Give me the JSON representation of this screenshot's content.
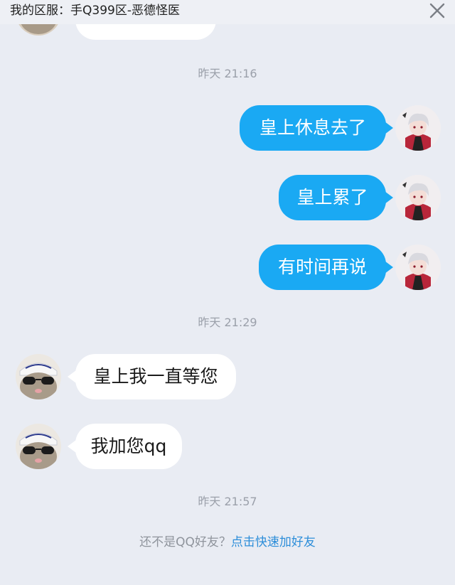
{
  "header": {
    "title": "我的区服：手Q399区-恶德怪医",
    "close_icon": "close-icon"
  },
  "messages": {
    "timestamp_1": "昨天 21:16",
    "sent_1": "皇上休息去了",
    "sent_2": "皇上累了",
    "sent_3": "有时间再说",
    "timestamp_2": "昨天 21:29",
    "received_1": "皇上我一直等您",
    "received_2": "我加您qq",
    "timestamp_3": "昨天 21:57"
  },
  "footer": {
    "prefix": "还不是QQ好友？",
    "link": "点击快速加好友"
  },
  "colors": {
    "background": "#e9ecf3",
    "sent_bubble": "#1aa9f3",
    "received_bubble": "#ffffff",
    "timestamp_text": "#9ba0aa",
    "link": "#2d8ed9"
  },
  "avatars": {
    "self": "anime-character-avatar",
    "other": "cat-with-sunglasses-avatar"
  }
}
